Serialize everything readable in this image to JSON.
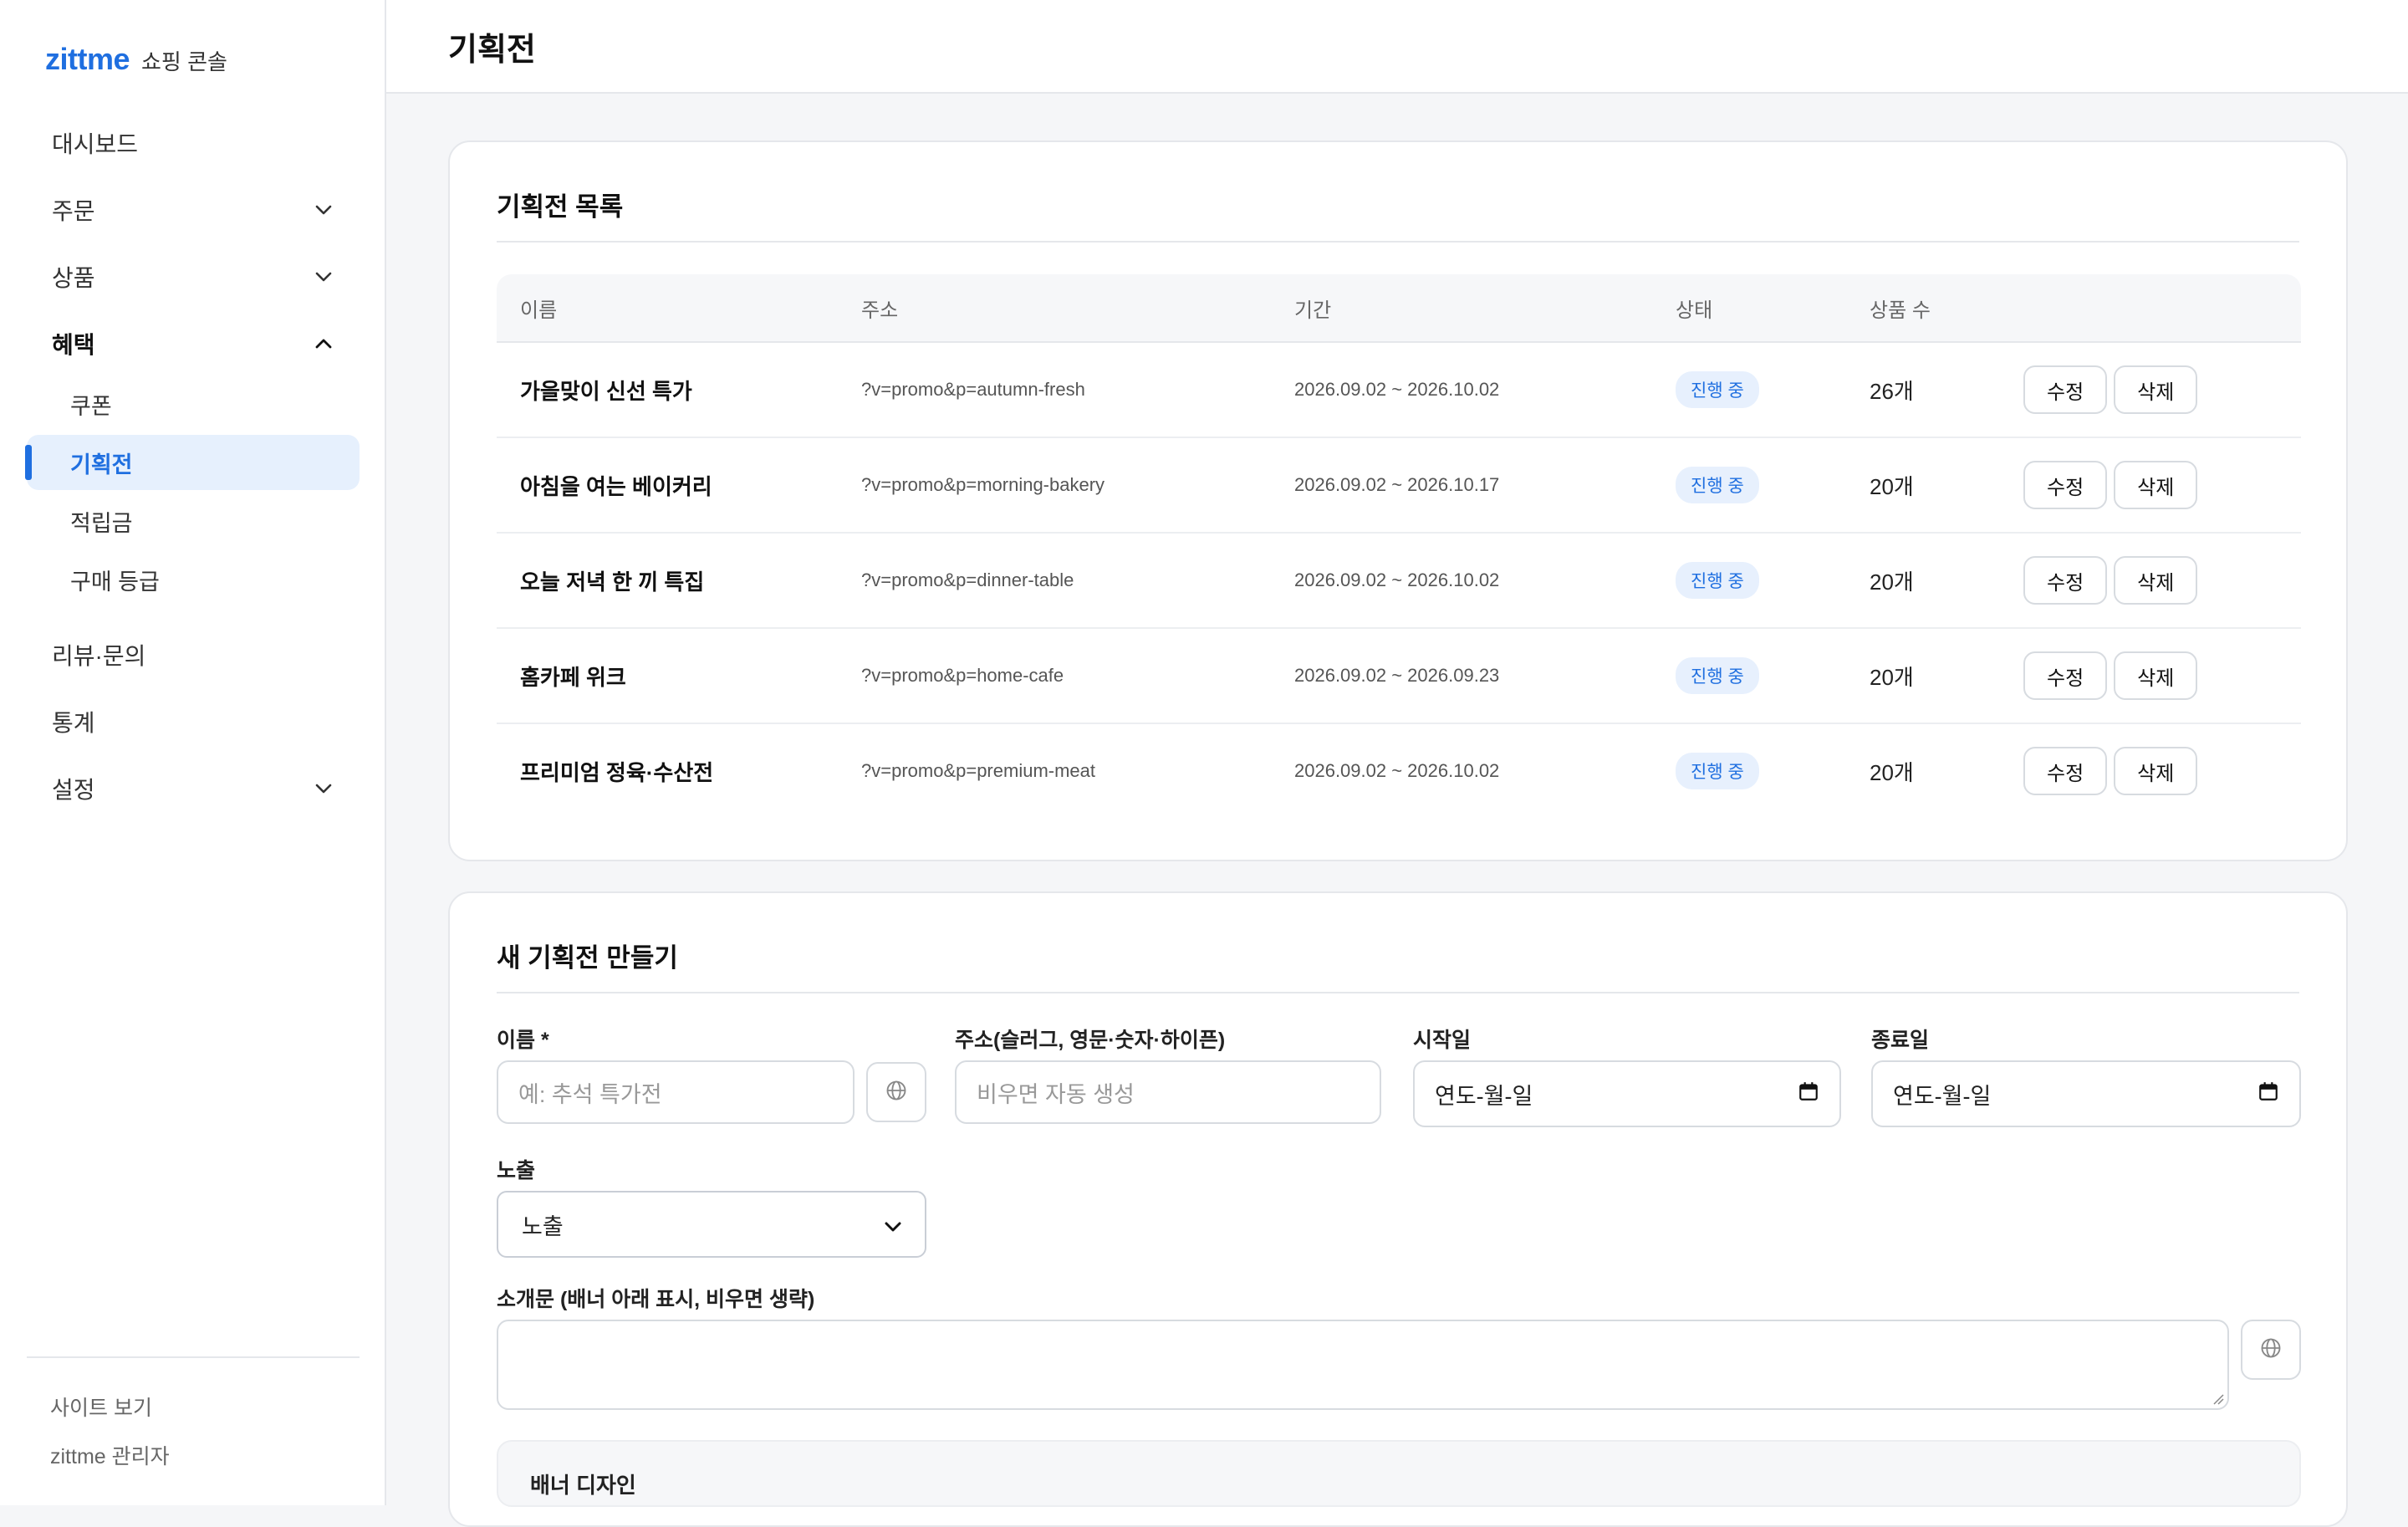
{
  "brand": {
    "logo": "zittme",
    "subtitle": "쇼핑 콘솔"
  },
  "sidebar": {
    "items": [
      {
        "label": "대시보드"
      },
      {
        "label": "주문"
      },
      {
        "label": "상품"
      },
      {
        "label": "혜택"
      },
      {
        "label": "리뷰·문의"
      },
      {
        "label": "통계"
      },
      {
        "label": "설정"
      }
    ],
    "benefit_sub": [
      {
        "label": "쿠폰"
      },
      {
        "label": "기획전"
      },
      {
        "label": "적립금"
      },
      {
        "label": "구매 등급"
      }
    ],
    "footer": {
      "view_site": "사이트 보기",
      "admin": "zittme 관리자"
    }
  },
  "header": {
    "title": "기획전"
  },
  "list": {
    "title": "기획전 목록",
    "columns": {
      "name": "이름",
      "url": "주소",
      "period": "기간",
      "status": "상태",
      "count": "상품 수"
    },
    "rows": [
      {
        "name": "가을맞이 신선 특가",
        "url": "?v=promo&p=autumn-fresh",
        "period": "2026.09.02 ~ 2026.10.02",
        "status": "진행 중",
        "count": "26개",
        "edit": "수정",
        "delete": "삭제"
      },
      {
        "name": "아침을 여는 베이커리",
        "url": "?v=promo&p=morning-bakery",
        "period": "2026.09.02 ~ 2026.10.17",
        "status": "진행 중",
        "count": "20개",
        "edit": "수정",
        "delete": "삭제"
      },
      {
        "name": "오늘 저녁 한 끼 특집",
        "url": "?v=promo&p=dinner-table",
        "period": "2026.09.02 ~ 2026.10.02",
        "status": "진행 중",
        "count": "20개",
        "edit": "수정",
        "delete": "삭제"
      },
      {
        "name": "홈카페 위크",
        "url": "?v=promo&p=home-cafe",
        "period": "2026.09.02 ~ 2026.09.23",
        "status": "진행 중",
        "count": "20개",
        "edit": "수정",
        "delete": "삭제"
      },
      {
        "name": "프리미엄 정육·수산전",
        "url": "?v=promo&p=premium-meat",
        "period": "2026.09.02 ~ 2026.10.02",
        "status": "진행 중",
        "count": "20개",
        "edit": "수정",
        "delete": "삭제"
      }
    ]
  },
  "form": {
    "title": "새 기획전 만들기",
    "name_label": "이름 *",
    "name_placeholder": "예: 추석 특가전",
    "slug_label": "주소(슬러그, 영문·숫자·하이픈)",
    "slug_placeholder": "비우면 자동 생성",
    "start_label": "시작일",
    "start_value": "연도-월-일",
    "end_label": "종료일",
    "end_value": "연도-월-일",
    "visibility_label": "노출",
    "visibility_value": "노출",
    "intro_label": "소개문 (배너 아래 표시, 비우면 생략)",
    "banner_title": "배너 디자인"
  },
  "colors": {
    "accent": "#1f6fe0",
    "accent_bg": "#e6f0fd"
  },
  "icons": {
    "expand": "chevron-down-icon",
    "collapse": "chevron-up-icon",
    "translate": "globe-icon",
    "date": "calendar-icon"
  }
}
